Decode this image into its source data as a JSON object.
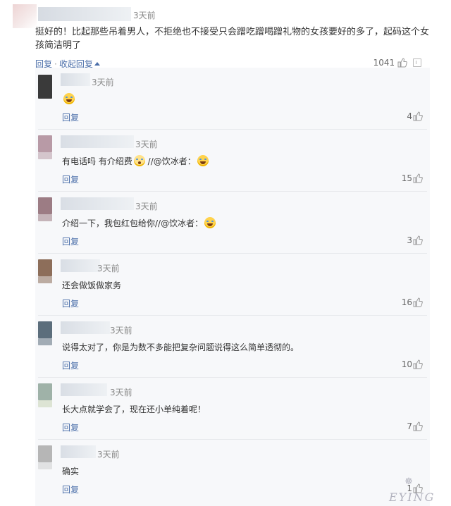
{
  "main_comment": {
    "time": "3天前",
    "text": "挺好的！比起那些吊着男人，不拒绝也不接受只会蹭吃蹭喝蹭礼物的女孩要好的多了，起码这个女孩简洁明了",
    "reply_label": "回复",
    "separator": "·",
    "collapse_label": "收起回复",
    "like_count": "1041"
  },
  "replies": [
    {
      "time": "3天前",
      "text": "",
      "emoji": "cry-laugh-emoji",
      "reply_label": "回复",
      "likes": "4",
      "avatar_color": "#3a3a3a"
    },
    {
      "time": "3天前",
      "text": "有电话吗 有介绍费",
      "text_tail": "//@饮冰者：",
      "reply_label": "回复",
      "likes": "15",
      "avatar_color": "#b89aa6"
    },
    {
      "time": "3天前",
      "text": "介绍一下，我包红包给你//@饮冰者：",
      "reply_label": "回复",
      "likes": "3",
      "avatar_color": "#9c7c84"
    },
    {
      "time": "3天前",
      "text": "还会做饭做家务",
      "reply_label": "回复",
      "likes": "16",
      "avatar_color": "#8d6e5a"
    },
    {
      "time": "3天前",
      "text": "说得太对了，你是为数不多能把复杂问题说得这么简单透彻的。",
      "reply_label": "回复",
      "likes": "10",
      "avatar_color": "#5c6e7c"
    },
    {
      "time": "3天前",
      "text": "长大点就学会了，现在还小单纯着呢！",
      "reply_label": "回复",
      "likes": "7",
      "avatar_color": "#9fb2a8"
    },
    {
      "time": "3天前",
      "text": "确实",
      "reply_label": "回复",
      "likes": "1",
      "avatar_color": "#b6b6b6"
    }
  ],
  "watermark": {
    "text": "EYING"
  },
  "colors": {
    "link": "#4a6ea9",
    "panel_bg": "#f7f8fa",
    "divider": "#e7e9ec"
  }
}
